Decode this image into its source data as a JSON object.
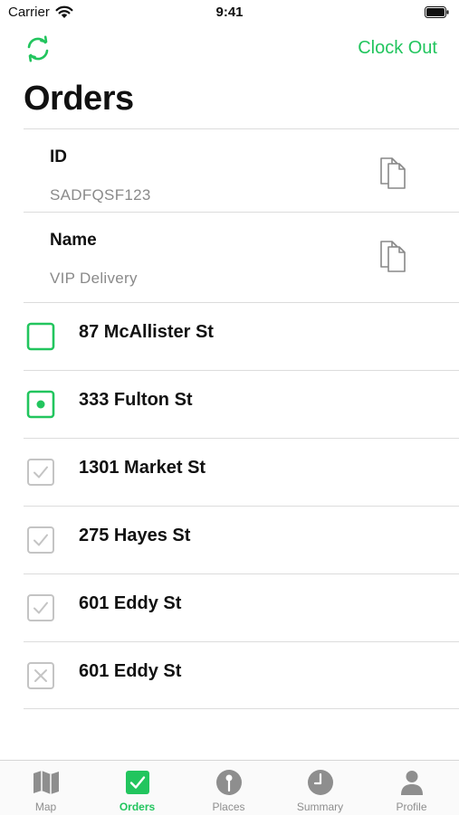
{
  "status_bar": {
    "carrier": "Carrier",
    "time": "9:41"
  },
  "header": {
    "clock_out_label": "Clock Out",
    "title": "Orders"
  },
  "order_info": {
    "id_label": "ID",
    "id_value": "SADFQSF123",
    "name_label": "Name",
    "name_value": "VIP Delivery"
  },
  "stops": [
    {
      "address": "87 McAllister St",
      "status": "pending"
    },
    {
      "address": "333 Fulton St",
      "status": "current"
    },
    {
      "address": "1301 Market St",
      "status": "completed"
    },
    {
      "address": "275 Hayes St",
      "status": "completed"
    },
    {
      "address": "601 Eddy St",
      "status": "completed"
    },
    {
      "address": "601 Eddy St",
      "status": "failed"
    }
  ],
  "tabs": [
    {
      "label": "Map",
      "icon": "map-icon",
      "active": false
    },
    {
      "label": "Orders",
      "icon": "checkbox-icon",
      "active": true
    },
    {
      "label": "Places",
      "icon": "pin-icon",
      "active": false
    },
    {
      "label": "Summary",
      "icon": "clock-icon",
      "active": false
    },
    {
      "label": "Profile",
      "icon": "person-icon",
      "active": false
    }
  ],
  "colors": {
    "accent": "#22c55e",
    "muted": "#8e8e8e",
    "done_gray": "#c4c4c4"
  }
}
